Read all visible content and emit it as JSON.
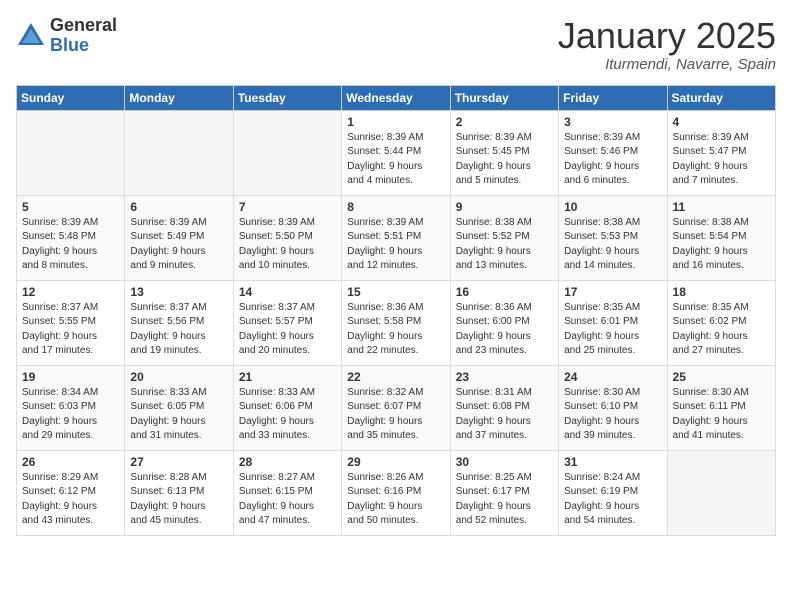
{
  "header": {
    "logo_general": "General",
    "logo_blue": "Blue",
    "month_title": "January 2025",
    "location": "Iturmendi, Navarre, Spain"
  },
  "weekdays": [
    "Sunday",
    "Monday",
    "Tuesday",
    "Wednesday",
    "Thursday",
    "Friday",
    "Saturday"
  ],
  "weeks": [
    [
      {
        "day": "",
        "info": ""
      },
      {
        "day": "",
        "info": ""
      },
      {
        "day": "",
        "info": ""
      },
      {
        "day": "1",
        "info": "Sunrise: 8:39 AM\nSunset: 5:44 PM\nDaylight: 9 hours\nand 4 minutes."
      },
      {
        "day": "2",
        "info": "Sunrise: 8:39 AM\nSunset: 5:45 PM\nDaylight: 9 hours\nand 5 minutes."
      },
      {
        "day": "3",
        "info": "Sunrise: 8:39 AM\nSunset: 5:46 PM\nDaylight: 9 hours\nand 6 minutes."
      },
      {
        "day": "4",
        "info": "Sunrise: 8:39 AM\nSunset: 5:47 PM\nDaylight: 9 hours\nand 7 minutes."
      }
    ],
    [
      {
        "day": "5",
        "info": "Sunrise: 8:39 AM\nSunset: 5:48 PM\nDaylight: 9 hours\nand 8 minutes."
      },
      {
        "day": "6",
        "info": "Sunrise: 8:39 AM\nSunset: 5:49 PM\nDaylight: 9 hours\nand 9 minutes."
      },
      {
        "day": "7",
        "info": "Sunrise: 8:39 AM\nSunset: 5:50 PM\nDaylight: 9 hours\nand 10 minutes."
      },
      {
        "day": "8",
        "info": "Sunrise: 8:39 AM\nSunset: 5:51 PM\nDaylight: 9 hours\nand 12 minutes."
      },
      {
        "day": "9",
        "info": "Sunrise: 8:38 AM\nSunset: 5:52 PM\nDaylight: 9 hours\nand 13 minutes."
      },
      {
        "day": "10",
        "info": "Sunrise: 8:38 AM\nSunset: 5:53 PM\nDaylight: 9 hours\nand 14 minutes."
      },
      {
        "day": "11",
        "info": "Sunrise: 8:38 AM\nSunset: 5:54 PM\nDaylight: 9 hours\nand 16 minutes."
      }
    ],
    [
      {
        "day": "12",
        "info": "Sunrise: 8:37 AM\nSunset: 5:55 PM\nDaylight: 9 hours\nand 17 minutes."
      },
      {
        "day": "13",
        "info": "Sunrise: 8:37 AM\nSunset: 5:56 PM\nDaylight: 9 hours\nand 19 minutes."
      },
      {
        "day": "14",
        "info": "Sunrise: 8:37 AM\nSunset: 5:57 PM\nDaylight: 9 hours\nand 20 minutes."
      },
      {
        "day": "15",
        "info": "Sunrise: 8:36 AM\nSunset: 5:58 PM\nDaylight: 9 hours\nand 22 minutes."
      },
      {
        "day": "16",
        "info": "Sunrise: 8:36 AM\nSunset: 6:00 PM\nDaylight: 9 hours\nand 23 minutes."
      },
      {
        "day": "17",
        "info": "Sunrise: 8:35 AM\nSunset: 6:01 PM\nDaylight: 9 hours\nand 25 minutes."
      },
      {
        "day": "18",
        "info": "Sunrise: 8:35 AM\nSunset: 6:02 PM\nDaylight: 9 hours\nand 27 minutes."
      }
    ],
    [
      {
        "day": "19",
        "info": "Sunrise: 8:34 AM\nSunset: 6:03 PM\nDaylight: 9 hours\nand 29 minutes."
      },
      {
        "day": "20",
        "info": "Sunrise: 8:33 AM\nSunset: 6:05 PM\nDaylight: 9 hours\nand 31 minutes."
      },
      {
        "day": "21",
        "info": "Sunrise: 8:33 AM\nSunset: 6:06 PM\nDaylight: 9 hours\nand 33 minutes."
      },
      {
        "day": "22",
        "info": "Sunrise: 8:32 AM\nSunset: 6:07 PM\nDaylight: 9 hours\nand 35 minutes."
      },
      {
        "day": "23",
        "info": "Sunrise: 8:31 AM\nSunset: 6:08 PM\nDaylight: 9 hours\nand 37 minutes."
      },
      {
        "day": "24",
        "info": "Sunrise: 8:30 AM\nSunset: 6:10 PM\nDaylight: 9 hours\nand 39 minutes."
      },
      {
        "day": "25",
        "info": "Sunrise: 8:30 AM\nSunset: 6:11 PM\nDaylight: 9 hours\nand 41 minutes."
      }
    ],
    [
      {
        "day": "26",
        "info": "Sunrise: 8:29 AM\nSunset: 6:12 PM\nDaylight: 9 hours\nand 43 minutes."
      },
      {
        "day": "27",
        "info": "Sunrise: 8:28 AM\nSunset: 6:13 PM\nDaylight: 9 hours\nand 45 minutes."
      },
      {
        "day": "28",
        "info": "Sunrise: 8:27 AM\nSunset: 6:15 PM\nDaylight: 9 hours\nand 47 minutes."
      },
      {
        "day": "29",
        "info": "Sunrise: 8:26 AM\nSunset: 6:16 PM\nDaylight: 9 hours\nand 50 minutes."
      },
      {
        "day": "30",
        "info": "Sunrise: 8:25 AM\nSunset: 6:17 PM\nDaylight: 9 hours\nand 52 minutes."
      },
      {
        "day": "31",
        "info": "Sunrise: 8:24 AM\nSunset: 6:19 PM\nDaylight: 9 hours\nand 54 minutes."
      },
      {
        "day": "",
        "info": ""
      }
    ]
  ]
}
